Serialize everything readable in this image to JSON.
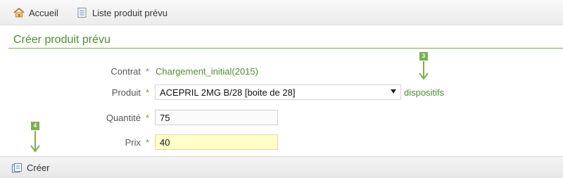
{
  "nav": {
    "home_label": "Accueil",
    "list_label": "Liste produit prévu"
  },
  "page": {
    "title": "Créer produit prévu"
  },
  "form": {
    "contract": {
      "label": "Contrat",
      "required_mark": "*",
      "value": "Chargement_initial(2015)"
    },
    "product": {
      "label": "Produit",
      "required_mark": "*",
      "selected": "ACEPRIL 2MG B/28 [boite de 28]",
      "link": "dispositifs"
    },
    "quantity": {
      "label": "Quantité",
      "required_mark": "*",
      "value": "75"
    },
    "price": {
      "label": "Prix",
      "required_mark": "*",
      "value": "40"
    }
  },
  "footer": {
    "create_label": "Créer"
  },
  "annotations": {
    "marker_3": "3",
    "marker_4": "4"
  },
  "colors": {
    "accent_green": "#4b8f2f",
    "marker_green": "#7ab04e",
    "highlight_input": "#ffffc8"
  },
  "icons": {
    "home": "home-icon",
    "list": "list-icon",
    "create": "create-icon",
    "select_caret": "chevron-down-icon",
    "arrow": "arrow-down-icon"
  }
}
